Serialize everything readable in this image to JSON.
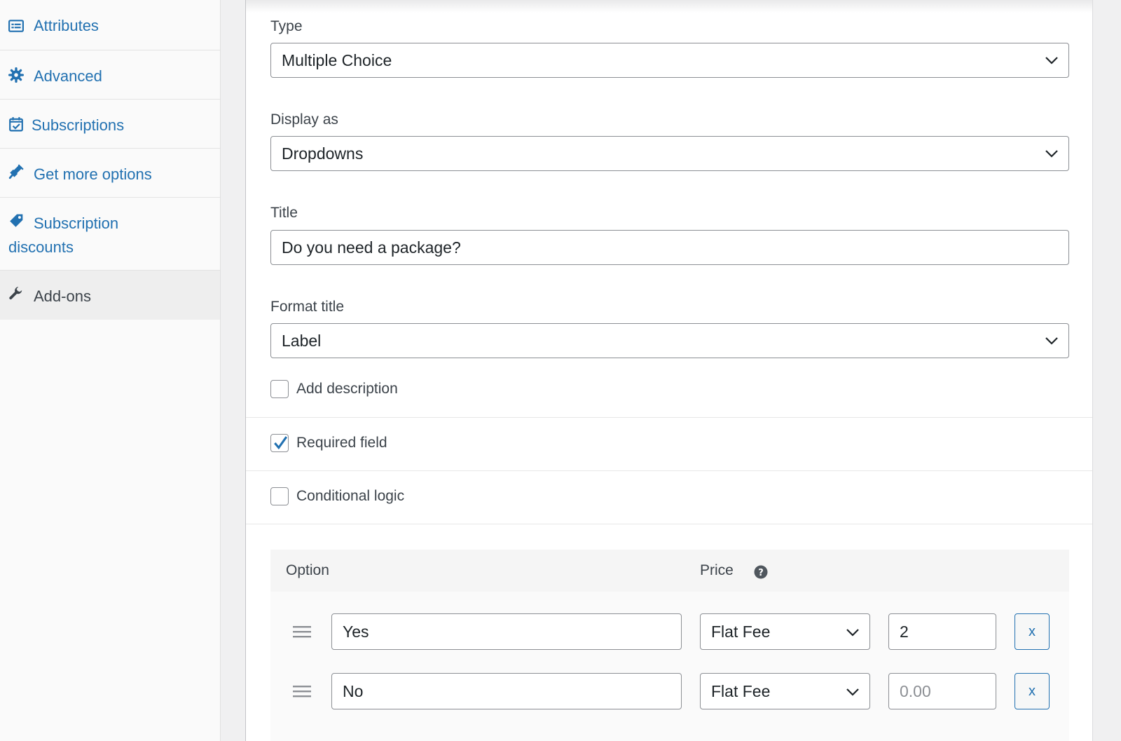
{
  "sidebar": {
    "items": [
      {
        "label": "Attributes",
        "icon": "list-view-icon",
        "active": false
      },
      {
        "label": "Advanced",
        "icon": "gear-icon",
        "active": false
      },
      {
        "label": "Subscriptions",
        "icon": "calendar-check-icon",
        "active": false
      },
      {
        "label": "Get more options",
        "icon": "plugin-icon",
        "active": false
      },
      {
        "label": "Subscription discounts",
        "icon": "tag-icon",
        "active": false
      },
      {
        "label": "Add-ons",
        "icon": "wrench-icon",
        "active": true
      }
    ]
  },
  "form": {
    "type": {
      "label": "Type",
      "value": "Multiple Choice"
    },
    "display_as": {
      "label": "Display as",
      "value": "Dropdowns"
    },
    "title": {
      "label": "Title",
      "value": "Do you need a package?"
    },
    "format_title": {
      "label": "Format title",
      "value": "Label"
    },
    "add_description": {
      "label": "Add description",
      "checked": false
    },
    "required_field": {
      "label": "Required field",
      "checked": true
    },
    "conditional_logic": {
      "label": "Conditional logic",
      "checked": false
    }
  },
  "options_table": {
    "headers": {
      "option": "Option",
      "price": "Price"
    },
    "rows": [
      {
        "option": "Yes",
        "price_type": "Flat Fee",
        "price": "2",
        "price_placeholder": "",
        "remove_label": "x"
      },
      {
        "option": "No",
        "price_type": "Flat Fee",
        "price": "",
        "price_placeholder": "0.00",
        "remove_label": "x"
      }
    ]
  },
  "colors": {
    "link": "#2271b1",
    "checkmark": "#2271b1",
    "sidebar_bg": "#fafafa",
    "active_item_bg": "#eeeeee"
  }
}
